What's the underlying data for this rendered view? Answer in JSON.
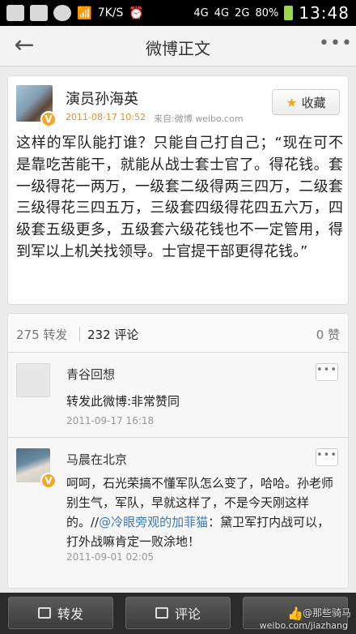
{
  "status_bar": {
    "network_speed": "7K/S",
    "signal_4g_a": "4G",
    "signal_4g_b": "4G",
    "signal_2g": "2G",
    "battery": "80%",
    "time": "13:48"
  },
  "header": {
    "back_icon": "arrow-left",
    "title": "微博正文",
    "more_icon": "more-dots"
  },
  "post": {
    "author": "演员孙海英",
    "verified_badge": "V",
    "time": "2011-08-17 10:52",
    "source": "来自:微博 weibo.com",
    "favorite_label": "收藏",
    "text": "这样的军队能打谁？只能自己打自己；“现在可不是靠吃苦能干，就能从战士套士官了。得花钱。套一级得花一两万，一级套二级得两三四万，二级套三级得花三四五万，三级套四级得花四五六万，四级套五级更多，五级套六级花钱也不一定管用，得到军以上机关找领导。士官提干部更得花钱。”"
  },
  "stats": {
    "reposts": "275 转发",
    "comments": "232 评论",
    "likes": "0 赞"
  },
  "comments": [
    {
      "name": "青谷回想",
      "text": "转发此微博:非常赞同",
      "time": "2011-09-17 16:18",
      "menu_icon": "more-dots"
    },
    {
      "name": "马晨在北京",
      "verified_badge": "V",
      "text_before": "呵呵，石光荣搞不懂军队怎么变了，哈哈。孙老师别生气，军队，早就这样了，不是今天刚这样的。//",
      "mention": "@冷眼旁观的加菲猫",
      "text_after": "：黛卫军打内战可以，打外战嘛肯定一败涂地！",
      "time": "2011-09-01 02:05",
      "menu_icon": "more-dots"
    }
  ],
  "bottom_bar": {
    "repost_label": "转发",
    "comment_label": "评论"
  },
  "watermark": {
    "handle": "@那些骑马",
    "url": "weibo.com/jiazhang"
  }
}
